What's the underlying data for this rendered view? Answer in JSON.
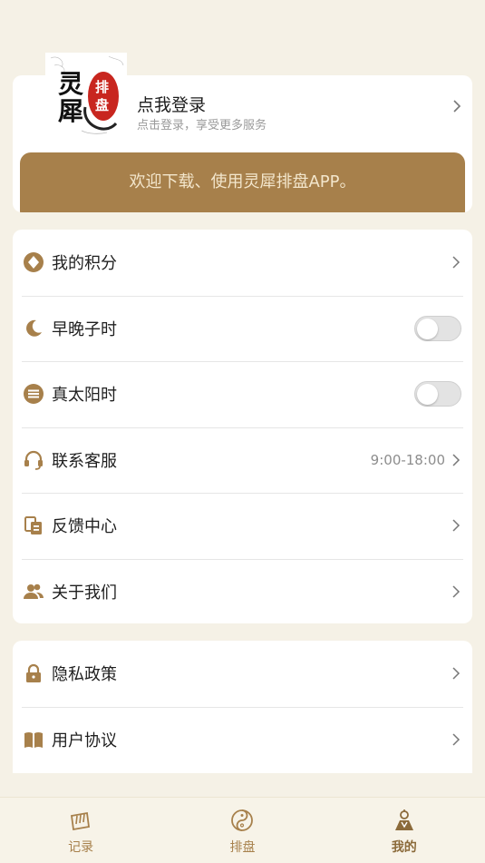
{
  "profile": {
    "logo_text_main": "灵犀",
    "logo_text_seal": "排盘",
    "login_title": "点我登录",
    "login_subtitle": "点击登录，享受更多服务",
    "banner_text": "欢迎下载、使用灵犀排盘APP。"
  },
  "menu1": [
    {
      "label": "我的积分",
      "icon": "points-diamond-icon",
      "type": "link"
    },
    {
      "label": "早晚子时",
      "icon": "moon-icon",
      "type": "toggle",
      "on": false
    },
    {
      "label": "真太阳时",
      "icon": "sun-time-icon",
      "type": "toggle",
      "on": false
    },
    {
      "label": "联系客服",
      "icon": "headset-icon",
      "type": "link",
      "hint": "9:00-18:00"
    },
    {
      "label": "反馈中心",
      "icon": "feedback-icon",
      "type": "link"
    },
    {
      "label": "关于我们",
      "icon": "users-icon",
      "type": "link"
    }
  ],
  "menu2": [
    {
      "label": "隐私政策",
      "icon": "lock-icon",
      "type": "link"
    },
    {
      "label": "用户协议",
      "icon": "book-icon",
      "type": "link"
    }
  ],
  "tabs": [
    {
      "label": "记录",
      "icon": "record-icon",
      "active": false
    },
    {
      "label": "排盘",
      "icon": "taiji-icon",
      "active": false
    },
    {
      "label": "我的",
      "icon": "profile-person-icon",
      "active": true
    }
  ],
  "colors": {
    "accent": "#a7804b",
    "background": "#f5f1e6",
    "seal_red": "#c8261f"
  }
}
